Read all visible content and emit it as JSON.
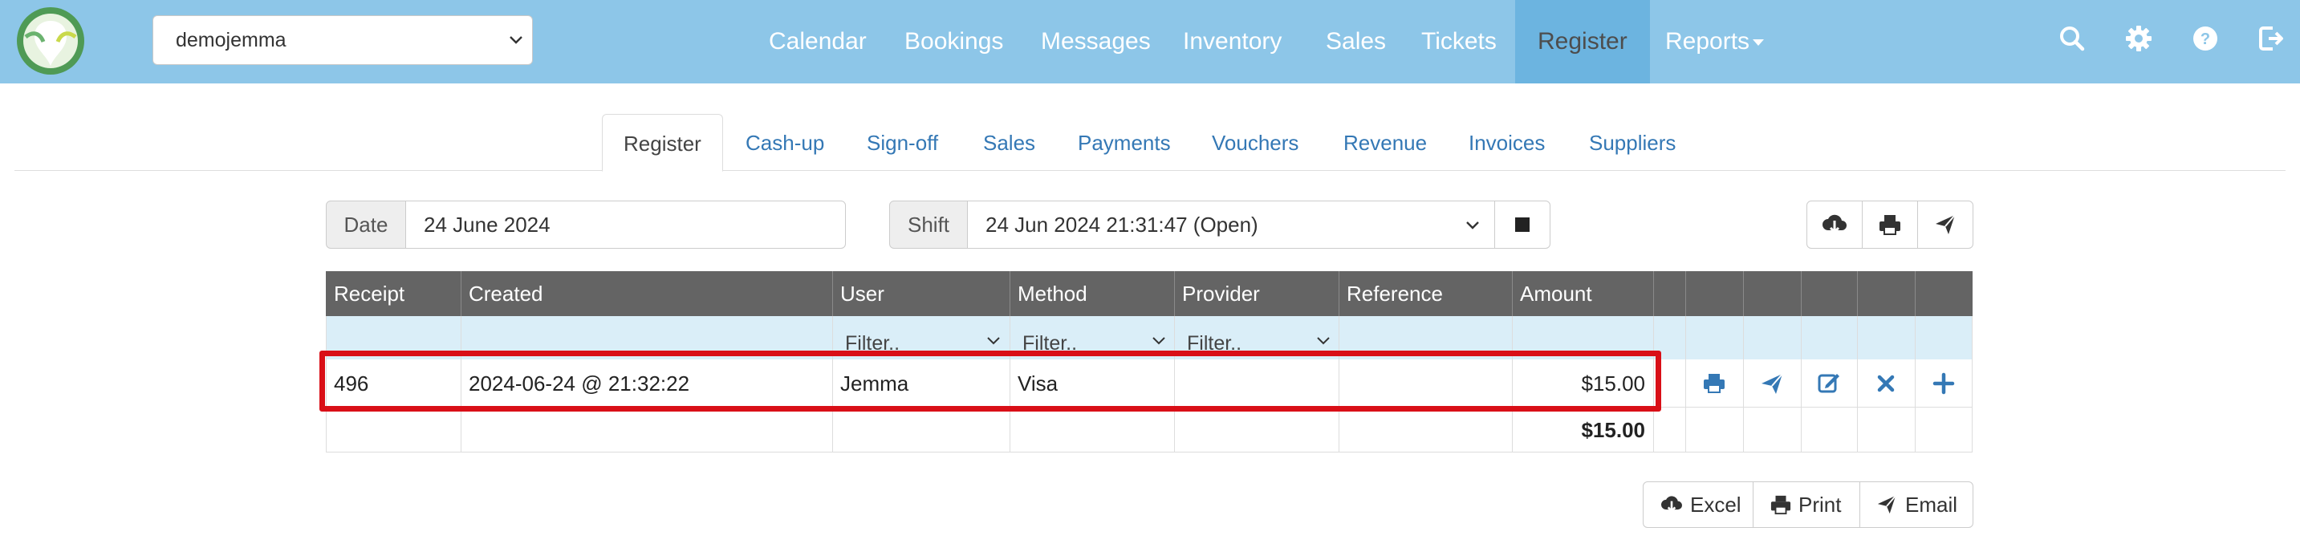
{
  "navbar": {
    "account": "demojemma",
    "items": [
      "Calendar",
      "Bookings",
      "Messages",
      "Inventory",
      "Sales",
      "Tickets",
      "Register",
      "Reports"
    ],
    "active": "Register",
    "icons": [
      "search-icon",
      "gear-icon",
      "help-icon",
      "logout-icon"
    ]
  },
  "tabs": [
    "Register",
    "Cash-up",
    "Sign-off",
    "Sales",
    "Payments",
    "Vouchers",
    "Revenue",
    "Invoices",
    "Suppliers"
  ],
  "controls": {
    "date_label": "Date",
    "date_value": "24 June 2024",
    "shift_label": "Shift",
    "shift_value": "24 Jun 2024 21:31:47 (Open)"
  },
  "table": {
    "columns": [
      "Receipt",
      "Created",
      "User",
      "Method",
      "Provider",
      "Reference",
      "Amount"
    ],
    "filter_placeholder": "Filter..",
    "rows": [
      {
        "receipt": "496",
        "created": "2024-06-24 @ 21:32:22",
        "user": "Jemma",
        "method": "Visa",
        "provider": "",
        "reference": "",
        "amount": "$15.00"
      }
    ],
    "total": "$15.00"
  },
  "export": {
    "excel": "Excel",
    "print": "Print",
    "email": "Email"
  },
  "colors": {
    "navbar": "#8dc6e8",
    "nav_active": "#6cb4e0",
    "link": "#3478b5",
    "table_header": "#646464",
    "filter_row": "#daeef8",
    "highlight": "#d90f17"
  }
}
